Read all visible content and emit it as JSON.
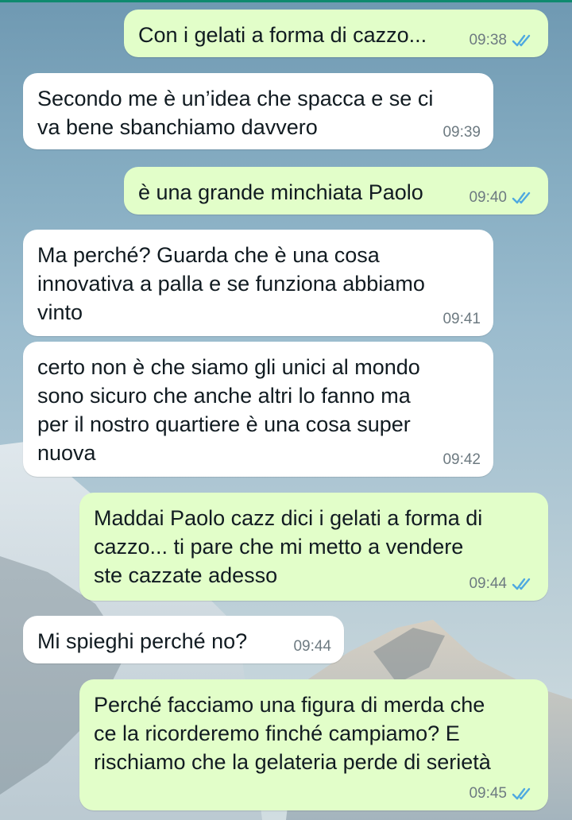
{
  "colors": {
    "outgoing_bubble": "#e2fec9",
    "incoming_bubble": "#ffffff",
    "read_ticks": "#4fa9e0",
    "timestamp": "#6d7a81",
    "top_bar": "#0f8a6f"
  },
  "messages": [
    {
      "direction": "outgoing",
      "text": "Con i gelati a forma di cazzo...",
      "time": "09:38",
      "status_icon": "double-check-read-icon"
    },
    {
      "direction": "incoming",
      "text": "Secondo me è un’idea che spacca e se ci\nva bene sbanchiamo davvero",
      "time": "09:39"
    },
    {
      "direction": "outgoing",
      "text": "è una grande minchiata Paolo",
      "time": "09:40",
      "status_icon": "double-check-read-icon"
    },
    {
      "direction": "incoming",
      "text": "Ma perché? Guarda che è una cosa\ninnovativa a palla e se funziona abbiamo\nvinto",
      "time": "09:41"
    },
    {
      "direction": "incoming",
      "text": "certo non è che siamo gli unici al mondo\nsono sicuro che anche altri lo fanno ma\nper il nostro quartiere è una cosa super\nnuova",
      "time": "09:42"
    },
    {
      "direction": "outgoing",
      "text": "Maddai Paolo cazz dici i gelati a forma di\ncazzo... ti pare che mi metto a vendere\nste cazzate adesso",
      "time": "09:44",
      "status_icon": "double-check-read-icon"
    },
    {
      "direction": "incoming",
      "text": "Mi spieghi perché no?",
      "time": "09:44"
    },
    {
      "direction": "outgoing",
      "text": "Perché facciamo una figura di merda che\nce la ricorderemo finché campiamo? E\nrischiamo che la gelateria perde di serietà",
      "time": "09:45",
      "status_icon": "double-check-read-icon"
    }
  ]
}
